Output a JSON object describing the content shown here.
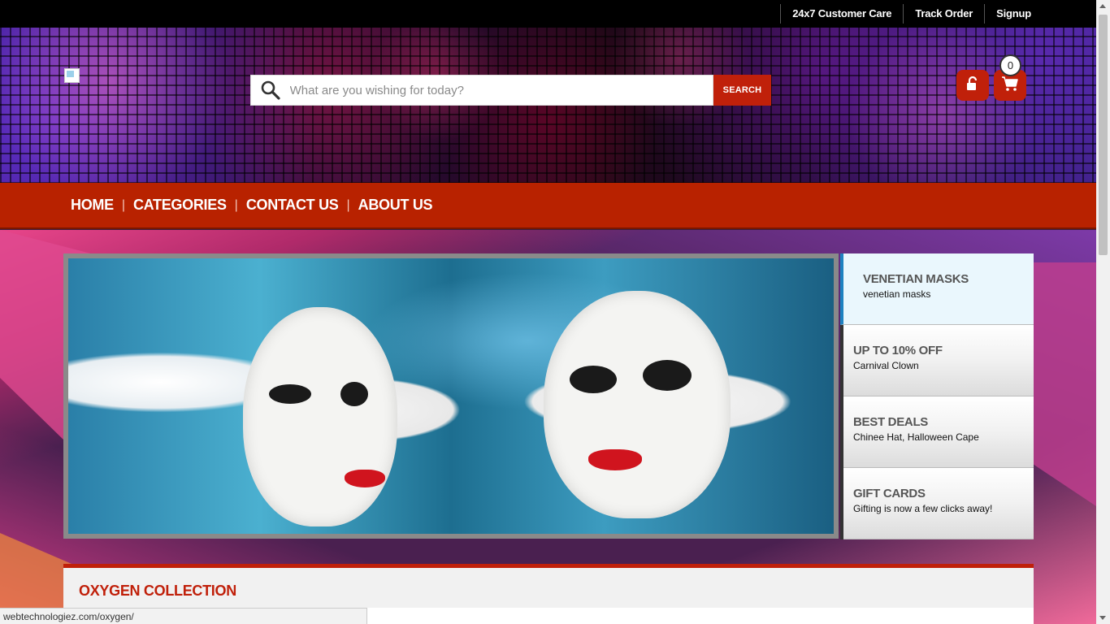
{
  "topbar": {
    "links": [
      "24x7 Customer Care",
      "Track Order",
      "Signup"
    ]
  },
  "header": {
    "logo_icon": "broken-image-icon",
    "search": {
      "placeholder": "What are you wishing for today?",
      "button_label": "SEARCH",
      "icon": "search-icon"
    },
    "lock_icon": "unlock-icon",
    "cart_icon": "cart-icon",
    "cart_count": "0"
  },
  "nav": {
    "items": [
      "HOME",
      "CATEGORIES",
      "CONTACT US",
      "ABOUT US"
    ]
  },
  "slider": {
    "tabs": [
      {
        "title": "VENETIAN MASKS",
        "subtitle": "venetian masks"
      },
      {
        "title": "UP TO 10% OFF",
        "subtitle": "Carnival Clown"
      },
      {
        "title": "BEST DEALS",
        "subtitle": "Chinee Hat, Halloween Cape"
      },
      {
        "title": "GIFT CARDS",
        "subtitle": "Gifting is now a few clicks away!"
      }
    ]
  },
  "collection": {
    "title": "OXYGEN COLLECTION"
  },
  "status_bar": {
    "url": "webtechnologiez.com/oxygen/"
  },
  "colors": {
    "accent": "#c0200a",
    "active_tab_border": "#1e82c0"
  }
}
